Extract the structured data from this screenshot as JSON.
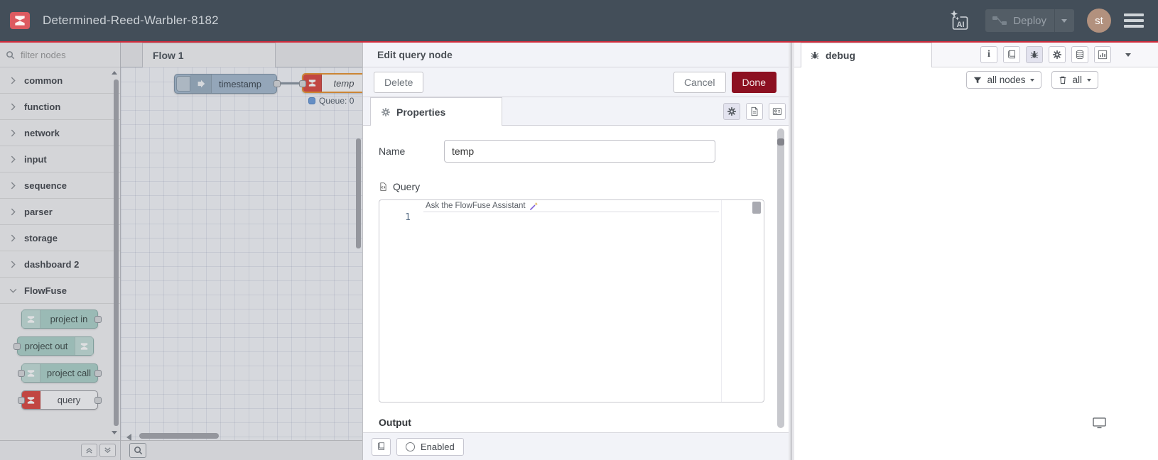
{
  "header": {
    "title": "Determined-Reed-Warbler-8182",
    "ai_label": "AI",
    "deploy_label": "Deploy",
    "avatar_initials": "st"
  },
  "palette": {
    "filter_placeholder": "filter nodes",
    "categories": [
      {
        "label": "common",
        "expanded": false
      },
      {
        "label": "function",
        "expanded": false
      },
      {
        "label": "network",
        "expanded": false
      },
      {
        "label": "input",
        "expanded": false
      },
      {
        "label": "sequence",
        "expanded": false
      },
      {
        "label": "parser",
        "expanded": false
      },
      {
        "label": "storage",
        "expanded": false
      },
      {
        "label": "dashboard 2",
        "expanded": false
      },
      {
        "label": "FlowFuse",
        "expanded": true
      }
    ],
    "flowfuse_nodes": [
      {
        "label": "project in"
      },
      {
        "label": "project out"
      },
      {
        "label": "project call"
      },
      {
        "label": "query"
      }
    ]
  },
  "workspace": {
    "tab_label": "Flow 1",
    "inject_node_label": "timestamp",
    "query_node_label": "temp",
    "query_node_status": "Queue: 0"
  },
  "tray": {
    "title": "Edit query node",
    "delete_label": "Delete",
    "cancel_label": "Cancel",
    "done_label": "Done",
    "properties_tab_label": "Properties",
    "name_label": "Name",
    "name_value": "temp",
    "query_label": "Query",
    "editor_line_number": "1",
    "assistant_placeholder": "Ask the FlowFuse Assistant",
    "output_label": "Output",
    "enabled_label": "Enabled"
  },
  "debug": {
    "tab_label": "debug",
    "filter_button_label": "all nodes",
    "clear_button_label": "all"
  },
  "colors": {
    "header_bg": "#434e59",
    "accent_red": "#d02c3c",
    "done_button_red": "#8c1021",
    "flowfuse_node_red": "#dd4840",
    "project_node_teal": "#aed3cb",
    "inject_node_blue": "#a6bbcf",
    "selected_node_border": "#e8932f",
    "status_dot_blue": "#6e9edd"
  }
}
